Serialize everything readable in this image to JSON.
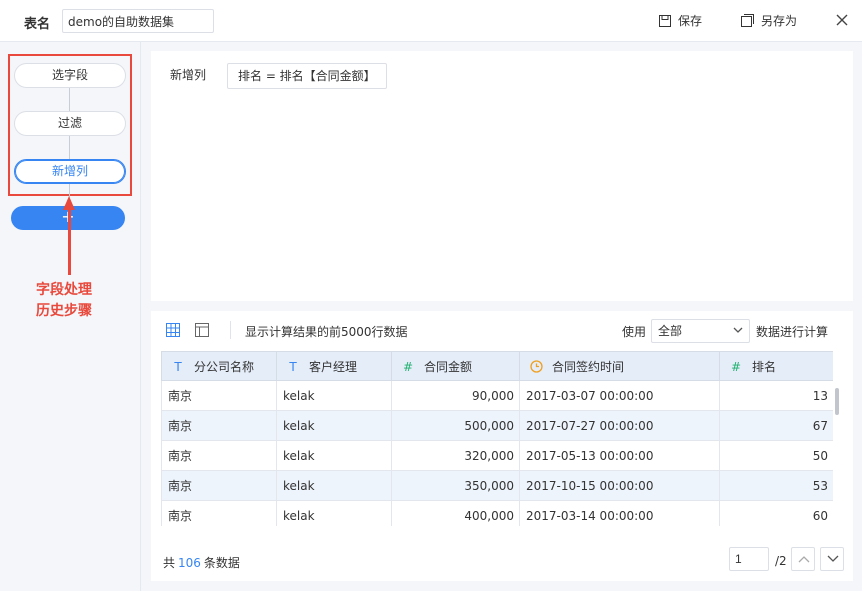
{
  "header": {
    "table_name_label": "表名",
    "table_name_value": "demo的自助数据集",
    "save_label": "保存",
    "save_as_label": "另存为"
  },
  "sidebar": {
    "steps": [
      {
        "label": "选字段"
      },
      {
        "label": "过滤"
      },
      {
        "label": "新增列"
      }
    ],
    "add_label": "+",
    "annotation_line1": "字段处理",
    "annotation_line2": "历史步骤"
  },
  "editor": {
    "label": "新增列",
    "formula": "排名 = 排名【合同金额】"
  },
  "preview": {
    "show_text": "显示计算结果的前5000行数据",
    "use_label": "使用",
    "scope_value": "全部",
    "calc_label": "数据进行计算",
    "columns": [
      {
        "type_icon": "T",
        "label": "分公司名称"
      },
      {
        "type_icon": "T",
        "label": "客户经理"
      },
      {
        "type_icon": "#",
        "label": "合同金额"
      },
      {
        "type_icon": "clock",
        "label": "合同签约时间"
      },
      {
        "type_icon": "#",
        "label": "排名"
      }
    ],
    "rows": [
      [
        "南京",
        "kelak",
        "90,000",
        "2017-03-07 00:00:00",
        "13"
      ],
      [
        "南京",
        "kelak",
        "500,000",
        "2017-07-27 00:00:00",
        "67"
      ],
      [
        "南京",
        "kelak",
        "320,000",
        "2017-05-13 00:00:00",
        "50"
      ],
      [
        "南京",
        "kelak",
        "350,000",
        "2017-10-15 00:00:00",
        "53"
      ],
      [
        "南京",
        "kelak",
        "400,000",
        "2017-03-14 00:00:00",
        "60"
      ]
    ],
    "total_prefix": "共",
    "total_count": "106",
    "total_suffix": "条数据",
    "page_current": "1",
    "page_total": "/2"
  },
  "colors": {
    "accent": "#3685f2",
    "annotation": "#e8493c",
    "header_bg": "#e5edf9",
    "row_alt": "#eef4fc",
    "clock_icon": "#f0a020",
    "number_icon": "#22b070",
    "text_icon": "#3685f2"
  }
}
